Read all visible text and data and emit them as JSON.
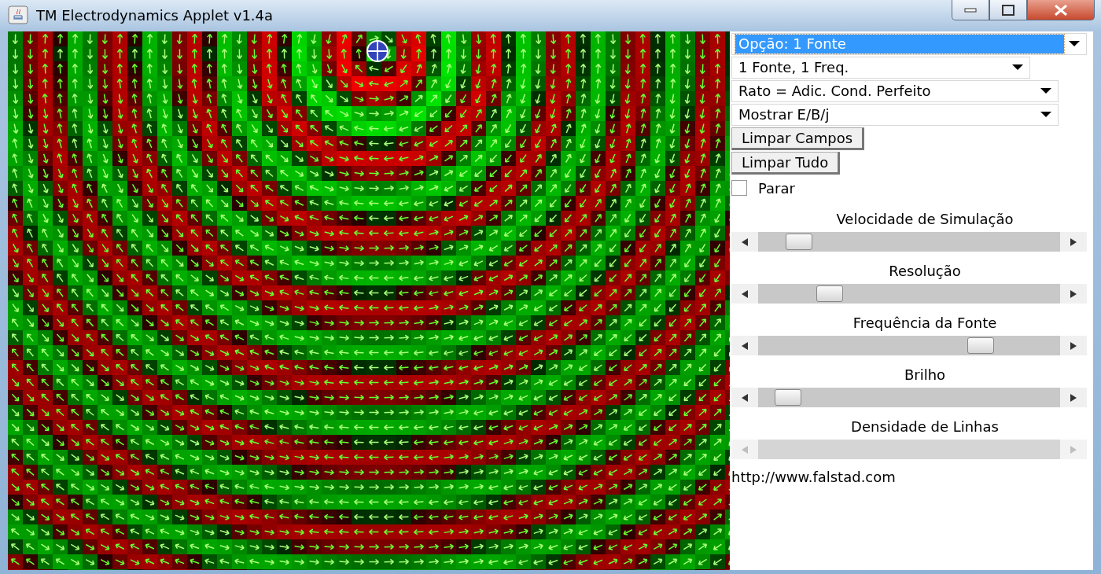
{
  "window": {
    "title": "TM Electrodynamics Applet v1.4a"
  },
  "dropdowns": [
    {
      "value": "Opção: 1 Fonte",
      "focused": true
    },
    {
      "value": "1 Fonte, 1 Freq.",
      "focused": false
    },
    {
      "value": "Rato = Adic. Cond. Perfeito",
      "focused": false
    },
    {
      "value": "Mostrar E/B/j",
      "focused": false
    }
  ],
  "buttons": [
    "Limpar Campos",
    "Limpar Tudo"
  ],
  "checkbox": {
    "label": "Parar",
    "checked": false
  },
  "sliders": [
    {
      "label": "Velocidade de Simulação",
      "level": 0.1,
      "disabled": false
    },
    {
      "label": "Resolução",
      "level": 0.21,
      "disabled": false
    },
    {
      "label": "Frequência da Fonte",
      "level": 0.76,
      "disabled": false
    },
    {
      "label": "Brilho",
      "level": 0.06,
      "disabled": false
    },
    {
      "label": "Densidade de Linhas",
      "disabled": true
    }
  ],
  "link": "http://www.falstad.com"
}
